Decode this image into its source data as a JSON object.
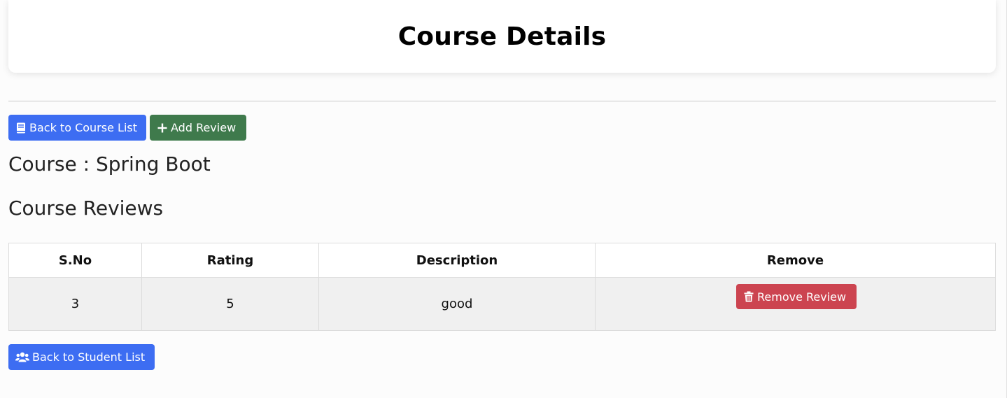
{
  "header": {
    "title": "Course Details"
  },
  "actions": {
    "back_to_course_list": "Back to Course List",
    "add_review": "Add Review",
    "back_to_student_list": "Back to Student List"
  },
  "course": {
    "label": "Course : Spring Boot"
  },
  "reviews": {
    "heading": "Course Reviews",
    "columns": [
      "S.No",
      "Rating",
      "Description",
      "Remove"
    ],
    "rows": [
      {
        "sno": "3",
        "rating": "5",
        "description": "good",
        "remove_label": "Remove Review"
      }
    ]
  },
  "icons": {
    "back_to_course_list": "book-icon",
    "add_review": "plus-icon",
    "remove_review": "trash-icon",
    "back_to_student_list": "users-icon"
  },
  "colors": {
    "primary": "#3d6df2",
    "success": "#3f7a4c",
    "danger": "#cc4450"
  }
}
